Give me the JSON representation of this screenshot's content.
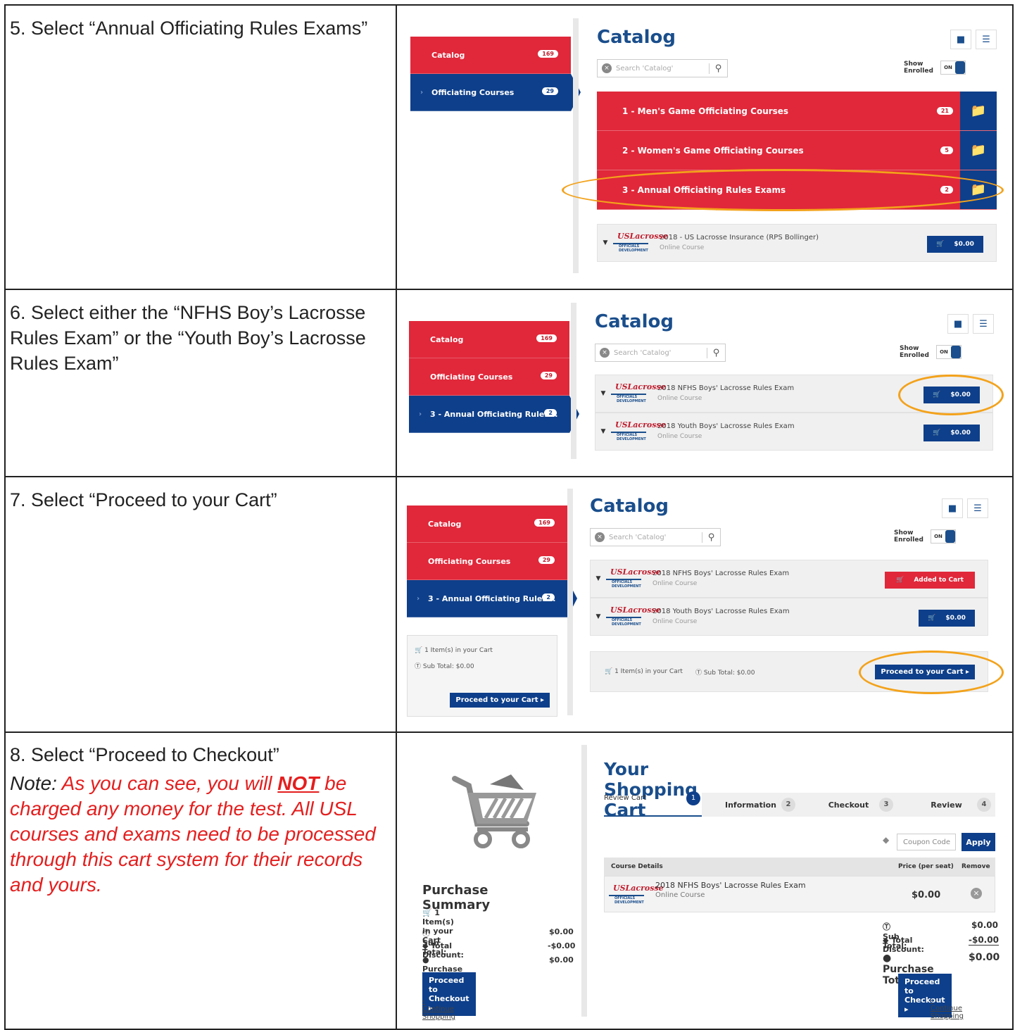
{
  "steps": [
    {
      "text": "5. Select “Annual Officiating Rules Exams”"
    },
    {
      "text": "6. Select either the “NFHS Boy’s Lacrosse Rules Exam” or the “Youth Boy’s Lacrosse Rules Exam”"
    },
    {
      "text": "7. Select “Proceed to your Cart”"
    },
    {
      "text": "8. Select “Proceed to Checkout”"
    }
  ],
  "note": {
    "lead": "Note:",
    "part1": " As you can see, you will ",
    "strong": "NOT",
    "part2": " be charged any money for the test. All USL courses and exams need to be processed through this cart system for their records and yours."
  },
  "catalog": {
    "title": "Catalog",
    "search_placeholder": "Search 'Catalog'",
    "show_enrolled": "Show Enrolled",
    "toggle": "ON",
    "sidebar": {
      "catalog": "Catalog",
      "catalog_count_1": "169",
      "catalog_count_2": "169",
      "catalog_count_3": "169",
      "officiating": "Officiating Courses",
      "officiating_count": "29",
      "annual": "3 - Annual Officiating Rules...",
      "annual_count": "2"
    },
    "folders": [
      {
        "label": "1 - Men's Game Officiating Courses",
        "count": "21"
      },
      {
        "label": "2 - Women's Game Officiating Courses",
        "count": "5"
      },
      {
        "label": "3 - Annual Officiating Rules Exams",
        "count": "2"
      }
    ],
    "insurance": {
      "title": "2018 - US Lacrosse Insurance (RPS Bollinger)",
      "sub": "Online Course",
      "price": "$0.00"
    },
    "courses": [
      {
        "title": "2018 NFHS Boys' Lacrosse Rules Exam",
        "sub": "Online Course",
        "price": "$0.00"
      },
      {
        "title": "2018 Youth Boys' Lacrosse Rules Exam",
        "sub": "Online Course",
        "price": "$0.00"
      }
    ],
    "added_to_cart": "Added to Cart",
    "cart_items": "1 Item(s) in your Cart",
    "sub_total": "Sub Total: $0.00",
    "proceed_cart": "Proceed to your Cart ▸"
  },
  "logo": {
    "line1": "USLacrosse",
    "line2": "OFFICIALS DEVELOPMENT"
  },
  "summary": {
    "title": "Purchase Summary",
    "items": "1 Item(s) in your Cart",
    "sub_total_label": "Sub Total:",
    "sub_total": "$0.00",
    "discount_label": "Total Discount:",
    "discount": "-$0.00",
    "purchase_label": "Purchase Total:",
    "purchase": "$0.00",
    "checkout": "Proceed to Checkout ▸",
    "continue": "‹ Continue Shopping"
  },
  "cart": {
    "title": "Your Shopping Cart",
    "steps": [
      {
        "label": "Review Cart",
        "num": "1"
      },
      {
        "label": "Information",
        "num": "2"
      },
      {
        "label": "Checkout",
        "num": "3"
      },
      {
        "label": "Review",
        "num": "4"
      }
    ],
    "coupon": "Coupon Code",
    "apply": "Apply",
    "col_details": "Course Details",
    "col_price": "Price (per seat)",
    "col_remove": "Remove",
    "item_title": "2018 NFHS Boys' Lacrosse Rules Exam",
    "item_sub": "Online Course",
    "item_price": "$0.00",
    "sub_total_label": "Sub Total:",
    "sub_total": "$0.00",
    "discount_label": "Total Discount:",
    "discount": "-$0.00",
    "purchase_label": "Purchase Total:",
    "purchase": "$0.00",
    "checkout": "Proceed to Checkout ▸",
    "continue": "‹ Continue Shopping"
  },
  "colors": {
    "red": "#e0283a",
    "blue": "#0e3f8a",
    "highlight": "#f3a21b",
    "note": "#e41e1e"
  }
}
